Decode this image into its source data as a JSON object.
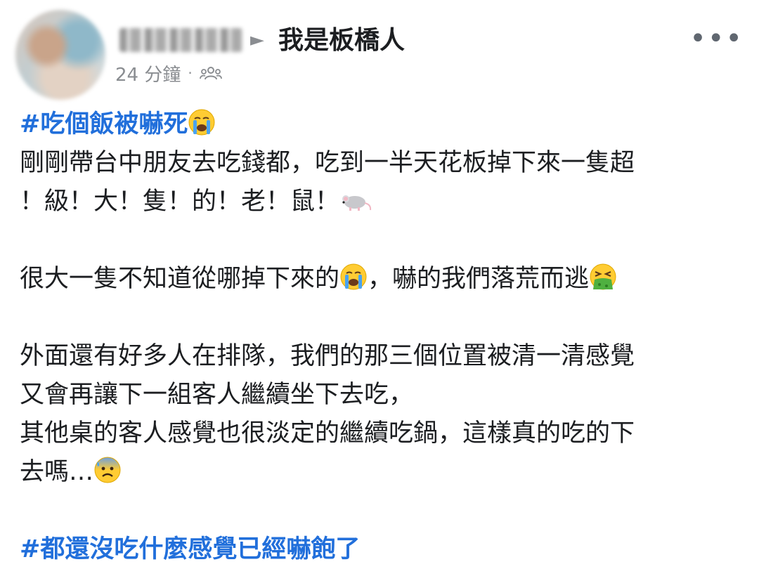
{
  "post": {
    "author_name": "",
    "group_arrow": "►",
    "group_name": "我是板橋人",
    "timestamp": "24 分鐘",
    "separator": "·",
    "privacy_icon": "group-icon",
    "more_label": "•••",
    "lines": {
      "hashtag1": "#吃個飯被嚇死",
      "line2": "剛剛帶台中朋友去吃錢都，吃到一半天花板掉下來一隻超",
      "line3": "！級！大！隻！的！老！鼠！",
      "line5a": "很大一隻不知道從哪掉下來的",
      "line5b": "，嚇的我們落荒而逃",
      "line7": "外面還有好多人在排隊，我們的那三個位置被清一清感覺",
      "line8": "又會再讓下一組客人繼續坐下去吃，",
      "line9": "其他桌的客人感覺也很淡定的繼續吃鍋，這樣真的吃的下",
      "line10": "去嗎…",
      "hashtag2": "#都還沒吃什麼感覺已經嚇飽了"
    },
    "emojis": {
      "crying": "crying-face",
      "mouse": "mouse",
      "vomit": "vomiting-face",
      "fearful": "anxious-face-with-sweat"
    }
  }
}
